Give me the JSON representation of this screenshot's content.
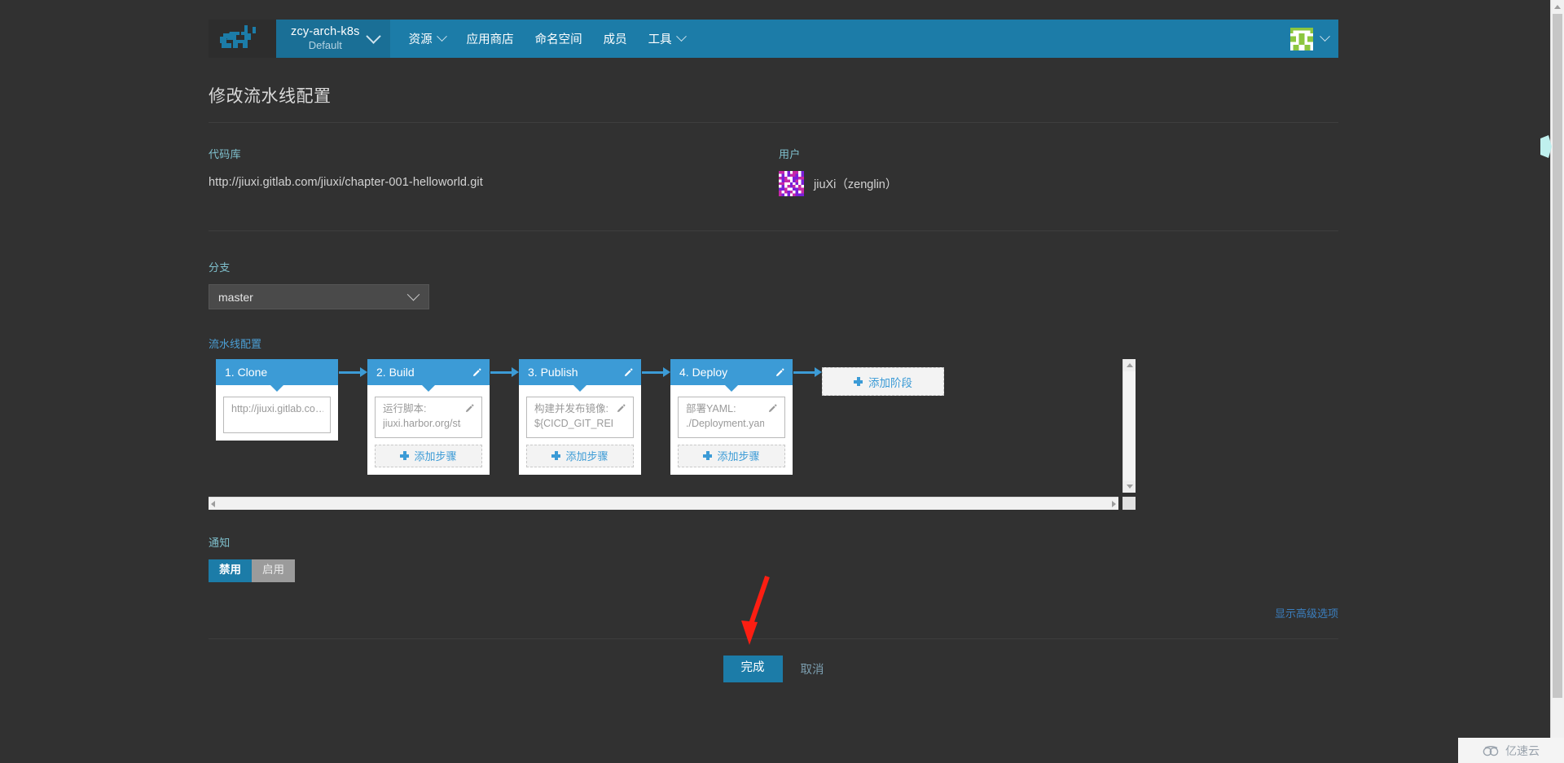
{
  "header": {
    "logo_icon": "ox-logo-icon",
    "project": {
      "name": "zcy-arch-k8s",
      "subtitle": "Default",
      "chevron_icon": "chevron-down-icon"
    },
    "nav": [
      {
        "label": "资源",
        "has_chevron": true
      },
      {
        "label": "应用商店",
        "has_chevron": false
      },
      {
        "label": "命名空间",
        "has_chevron": false
      },
      {
        "label": "成员",
        "has_chevron": false
      },
      {
        "label": "工具",
        "has_chevron": true
      }
    ],
    "account": {
      "avatar_icon": "user-avatar-identicon",
      "chevron_icon": "chevron-down-icon"
    }
  },
  "page": {
    "title": "修改流水线配置",
    "repo": {
      "label": "代码库",
      "url": "http://jiuxi.gitlab.com/jiuxi/chapter-001-helloworld.git"
    },
    "user": {
      "label": "用户",
      "name": "jiuXi（zenglin）",
      "avatar_icon": "user-identicon"
    },
    "branch": {
      "label": "分支",
      "value": "master",
      "chevron_icon": "chevron-down-icon"
    },
    "pipeline": {
      "label": "流水线配置",
      "add_stage_label": "添加阶段",
      "add_step_label": "添加步骤",
      "edit_icon": "pencil-icon",
      "plus_icon": "plus-icon",
      "stages": [
        {
          "title": "1. Clone",
          "editable": false,
          "steps": [
            {
              "line1": "http://jiuxi.gitlab.co…",
              "line2": "",
              "editable": false
            }
          ],
          "has_add_step": false
        },
        {
          "title": "2. Build",
          "editable": true,
          "steps": [
            {
              "line1": "运行脚本:",
              "line2": "jiuxi.harbor.org/sta…",
              "editable": true
            }
          ],
          "has_add_step": true
        },
        {
          "title": "3. Publish",
          "editable": true,
          "steps": [
            {
              "line1": "构建并发布镜像:",
              "line2": "${CICD_GIT_REPO_…",
              "editable": true
            }
          ],
          "has_add_step": true
        },
        {
          "title": "4. Deploy",
          "editable": true,
          "steps": [
            {
              "line1": "部署YAML:",
              "line2": "./Deployment.yaml",
              "editable": true
            }
          ],
          "has_add_step": true
        }
      ]
    },
    "notify": {
      "label": "通知",
      "options": [
        {
          "label": "禁用",
          "selected": true
        },
        {
          "label": "启用",
          "selected": false
        }
      ]
    },
    "advanced_link": "显示高级选项",
    "actions": {
      "submit": "完成",
      "cancel": "取消"
    }
  },
  "watermark": {
    "text": "亿速云",
    "icon": "cloud-icon"
  },
  "colors": {
    "page_bg": "#313131",
    "header_blue": "#1c7ca8",
    "stage_blue": "#3c9bd6",
    "accent_link": "#3b7fbf",
    "label_teal": "#7fc0cd",
    "annotation_red": "#fc1e12",
    "avatar_green": "#8cc63f"
  }
}
